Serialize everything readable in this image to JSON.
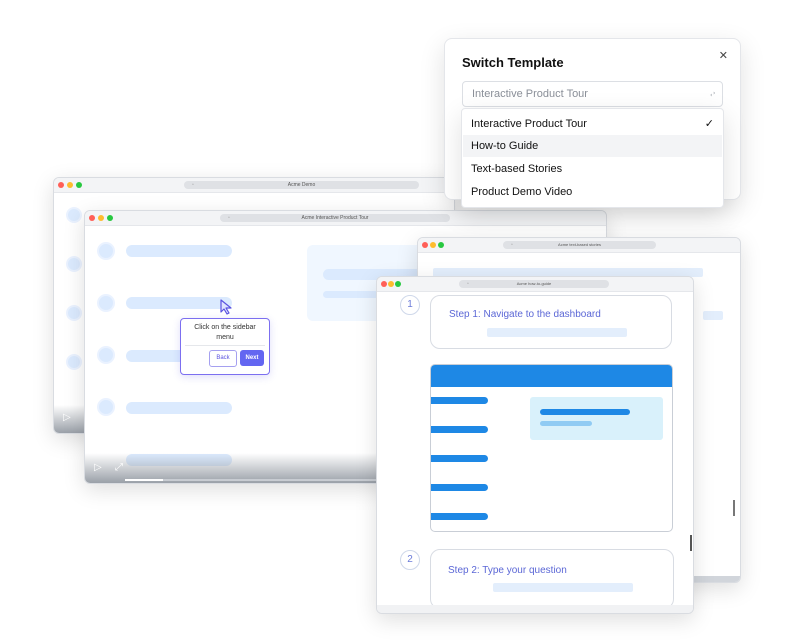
{
  "windows": {
    "acme_demo": {
      "title": "Acme Demo"
    },
    "interactive_tour": {
      "title": "Acme Interactive Product Tour"
    },
    "text_stories": {
      "title": "Acme text-based stories"
    },
    "how_to_guide": {
      "title": "Acme how-to-guide"
    }
  },
  "tooltip": {
    "text": "Click on the sidebar menu",
    "back_label": "Back",
    "next_label": "Next"
  },
  "guide": {
    "step1": {
      "number": "1",
      "title": "Step 1: Navigate to the dashboard"
    },
    "step2": {
      "number": "2",
      "title": "Step 2: Type your question"
    }
  },
  "switch_template": {
    "title": "Switch Template",
    "close_glyph": "✕",
    "selected": "Interactive Product Tour",
    "chevron_glyph": "⌃⌄",
    "check_glyph": "✓",
    "options": [
      "Interactive Product Tour",
      "How-to Guide",
      "Text-based Stories",
      "Product Demo Video"
    ],
    "highlighted_option": "How-to Guide"
  },
  "icons": {
    "play": "▷",
    "fullscreen": "⤢",
    "lock": "🔒︎",
    "cursor": "cursor-arrow-icon"
  },
  "colors": {
    "accent": "#6366f1",
    "primary_blue": "#1e88e5",
    "light_blue": "#dbeafe"
  }
}
